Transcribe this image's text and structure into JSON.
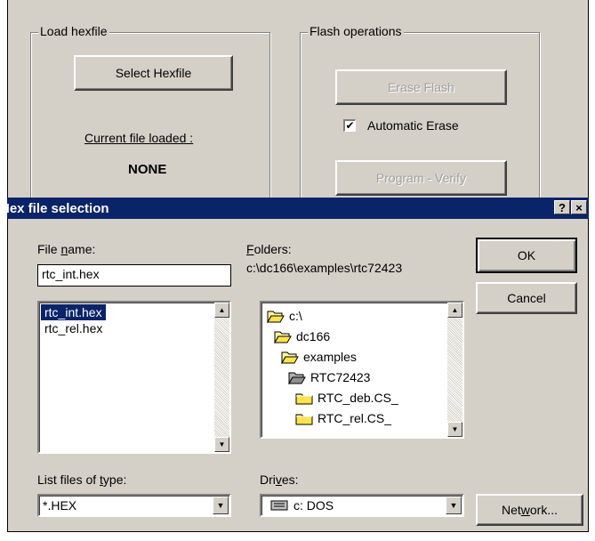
{
  "bg_window": {
    "load_group_title": "Load hexfile",
    "select_button": "Select Hexfile",
    "current_file_label": "Current file loaded :",
    "current_file_value": "NONE",
    "flash_group_title": "Flash operations",
    "erase_button": "Erase Flash",
    "automatic_erase_label": "Automatic Erase",
    "automatic_erase_checked": true,
    "program_button": "Program - Verify"
  },
  "dialog": {
    "title": "Hex file selection",
    "help_btn": "?",
    "close_btn": "×",
    "file_name_label_pre": "File ",
    "file_name_label_u": "n",
    "file_name_label_post": "ame:",
    "file_name_value": "rtc_int.hex",
    "files": [
      "rtc_int.hex",
      "rtc_rel.hex"
    ],
    "selected_file_index": 0,
    "folders_label_u": "F",
    "folders_label_post": "olders:",
    "current_path": "c:\\dc166\\examples\\rtc72423",
    "folders": [
      "c:\\",
      "dc166",
      "examples",
      "RTC72423",
      "RTC_deb.CS_",
      "RTC_rel.CS_"
    ],
    "ok_button": "OK",
    "cancel_button": "Cancel",
    "type_label_pre": "List files of ",
    "type_label_u": "t",
    "type_label_post": "ype:",
    "type_value": "*.HEX",
    "drives_label_pre": "Dri",
    "drives_label_u": "v",
    "drives_label_post": "es:",
    "drive_value": "c: DOS",
    "network_pre": "Net",
    "network_u": "w",
    "network_post": "ork..."
  },
  "colors": {
    "titlebar": "#0a246a",
    "face": "#d4d0c8",
    "folder_yellow": "#ffd700"
  }
}
